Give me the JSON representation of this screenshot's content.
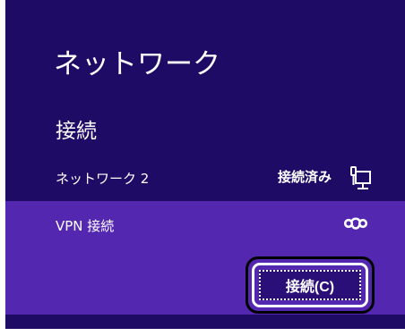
{
  "charms": {
    "title": "ネットワーク",
    "section_heading": "接続",
    "networks": [
      {
        "name": "ネットワーク 2",
        "status": "接続済み",
        "icon": "wired-network-icon"
      },
      {
        "name": "VPN 接続",
        "status": "",
        "icon": "vpn-link-icon"
      }
    ],
    "connect_button": {
      "label": "接続(C)"
    }
  },
  "colors": {
    "panel_background": "#1e0b66",
    "selected_row": "#5427b1",
    "button_fill": "#2b0f79",
    "text": "#ffffff"
  }
}
